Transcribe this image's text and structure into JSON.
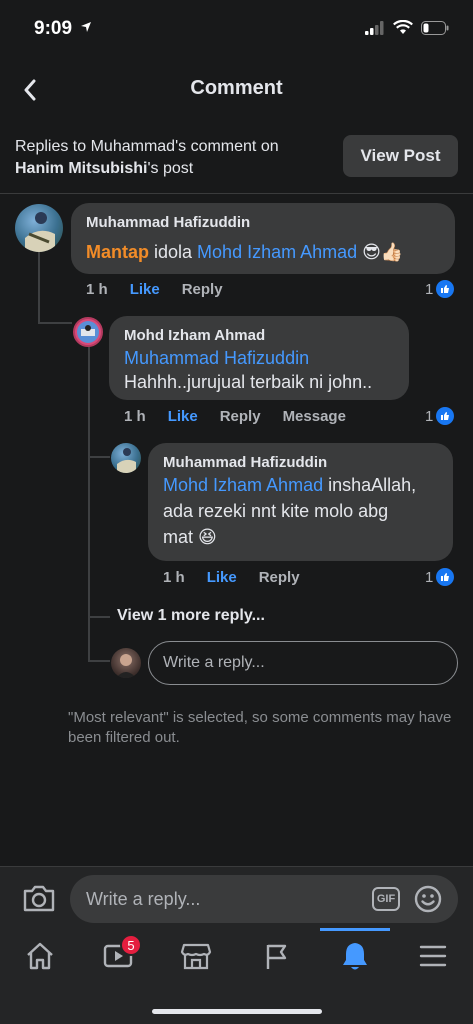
{
  "status": {
    "time": "9:09"
  },
  "header": {
    "title": "Comment"
  },
  "context": {
    "prefix": "Replies to Muhammad's comment on",
    "owner": "Hanim Mitsubishi",
    "suffix": "'s post",
    "view_post": "View Post"
  },
  "comments": [
    {
      "author": "Muhammad Hafizuddin",
      "text_highlight": "Mantap",
      "text_plain": " idola ",
      "mention": "Mohd Izham Ahmad",
      "emoji": "😎👍🏻",
      "time": "1 h",
      "like": "Like",
      "reply": "Reply",
      "reactions": "1"
    },
    {
      "author": "Mohd Izham Ahmad",
      "mention": "Muhammad Hafizuddin",
      "text": "Hahhh..jurujual terbaik ni john..",
      "time": "1 h",
      "like": "Like",
      "reply": "Reply",
      "message": "Message",
      "reactions": "1"
    },
    {
      "author": "Muhammad Hafizuddin",
      "mention": "Mohd Izham Ahmad",
      "text_line1": " inshaAllah,",
      "text_line2": "ada rezeki nnt kite molo abg",
      "text_line3": "mat ",
      "emoji": "😆",
      "time": "1 h",
      "like": "Like",
      "reply": "Reply",
      "reactions": "1"
    }
  ],
  "thread": {
    "view_more": "View 1 more reply...",
    "reply_placeholder": "Write a reply..."
  },
  "notice": "\"Most relevant\" is selected, so some comments may have been filtered out.",
  "composer": {
    "placeholder": "Write a reply...",
    "gif": "GIF"
  },
  "nav": {
    "items": [
      "home-icon",
      "watch-icon",
      "marketplace-icon",
      "pages-icon",
      "notifications-icon",
      "menu-icon"
    ],
    "watch_badge": "5",
    "active": "notifications-icon"
  },
  "colors": {
    "accent": "#4599ff",
    "background": "#18191a",
    "bubble": "#3a3b3c",
    "highlight": "#f28c28",
    "badge": "#e41e3f"
  }
}
